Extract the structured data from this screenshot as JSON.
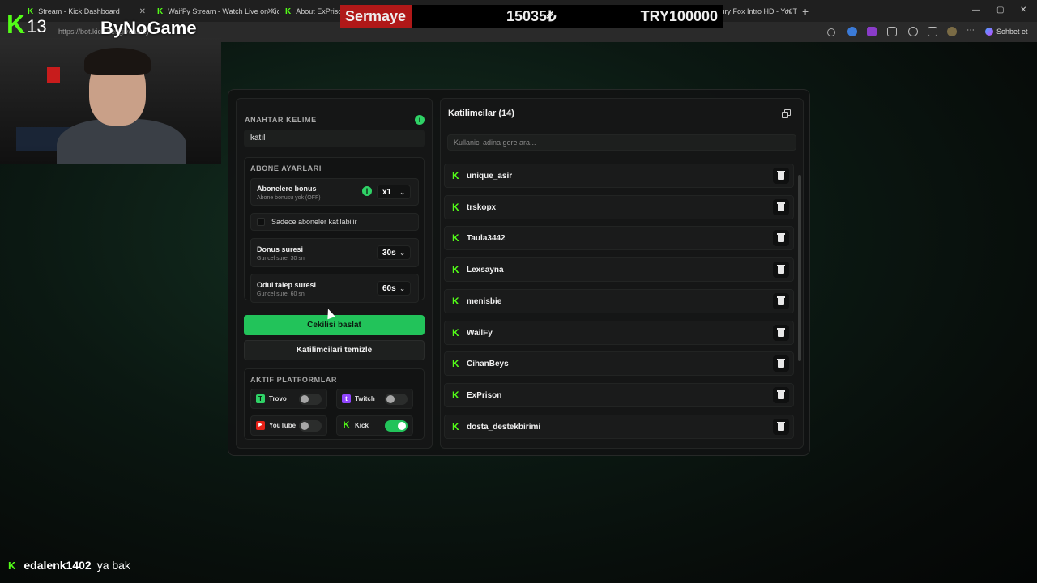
{
  "browser": {
    "tabs": [
      {
        "title": "Stream - Kick Dashboard"
      },
      {
        "title": "WaifFy Stream - Watch Live on Kick"
      },
      {
        "title": "About ExPrison"
      },
      {
        "title": "Fury Fox Intro HD - YouTube"
      }
    ],
    "url": "https://bot.kick.net/giveaway",
    "sohbet_label": "Sohbet et"
  },
  "overlay": {
    "brand_number": "13",
    "brand_name": "ByNoGame",
    "ticker_label": "Sermaye",
    "ticker_amount": "15035₺",
    "ticker_target": "TRY100000"
  },
  "panel": {
    "keyword_label": "ANAHTAR KELIME",
    "keyword_value": "katıl",
    "subscriber_section_label": "ABONE AYARLARI",
    "subscriber_bonus_title": "Abonelere bonus",
    "subscriber_bonus_subtitle": "Abone bonusu yok (OFF)",
    "subscriber_bonus_value": "x1",
    "subscribers_only_label": "Sadece aboneler katilabilir",
    "draw_duration_title": "Donus suresi",
    "draw_duration_subtitle": "Guncel sure: 30 sn",
    "draw_duration_value": "30s",
    "claim_duration_title": "Odul talep suresi",
    "claim_duration_subtitle": "Guncel sure: 60 sn",
    "claim_duration_value": "60s",
    "start_button": "Cekilisi baslat",
    "clear_button": "Katilimcilari temizle",
    "platforms_label": "AKTIF PLATFORMLAR",
    "platforms": [
      {
        "name": "Trovo",
        "enabled": false,
        "color": "#2fd266"
      },
      {
        "name": "Twitch",
        "enabled": false,
        "color": "#9146ff"
      },
      {
        "name": "YouTube",
        "enabled": false,
        "color": "#e62117"
      },
      {
        "name": "Kick",
        "enabled": true,
        "color": "#53fc18"
      }
    ]
  },
  "participants": {
    "title": "Katilimcilar (14)",
    "search_placeholder": "Kullanici adina gore ara...",
    "list": [
      "unique_asir",
      "trskopx",
      "Taula3442",
      "Lexsayna",
      "menisbie",
      "WailFy",
      "CihanBeys",
      "ExPrison",
      "dosta_destekbirimi"
    ]
  },
  "chat": {
    "username": "edalenk1402",
    "message": "ya bak"
  },
  "colors": {
    "accent_green": "#22c35a",
    "kick_green": "#53fc18",
    "panel_bg": "#151616"
  }
}
